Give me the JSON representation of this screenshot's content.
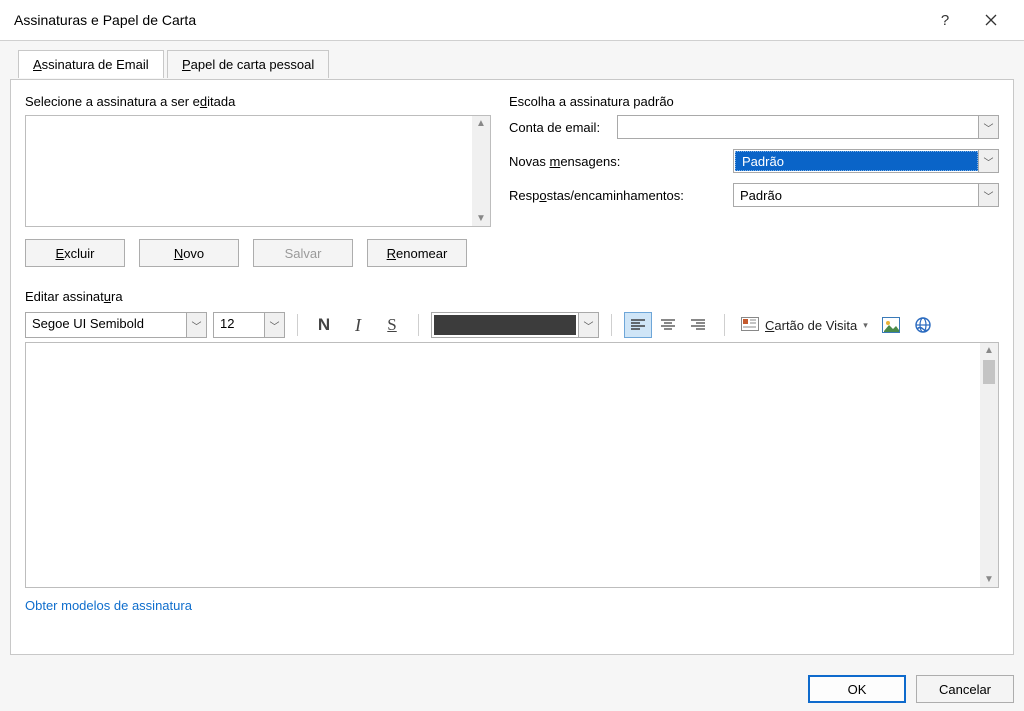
{
  "window": {
    "title": "Assinaturas e Papel de Carta"
  },
  "tabs": {
    "email": "Assinatura de Email",
    "stationery": "Papel de carta pessoal"
  },
  "left": {
    "select_label": "Selecione a assinatura a ser editada",
    "buttons": {
      "delete": "Excluir",
      "new": "Novo",
      "save": "Salvar",
      "rename": "Renomear"
    }
  },
  "right": {
    "heading": "Escolha a assinatura padrão",
    "email_account_label": "Conta de email:",
    "email_account_value": "",
    "new_messages_label": "Novas mensagens:",
    "new_messages_value": "Padrão",
    "replies_label": "Respostas/encaminhamentos:",
    "replies_value": "Padrão"
  },
  "editor": {
    "label": "Editar assinatura",
    "font_name": "Segoe UI Semibold",
    "font_size": "12",
    "business_card": "Cartão de Visita"
  },
  "link": "Obter modelos de assinatura",
  "footer": {
    "ok": "OK",
    "cancel": "Cancelar"
  }
}
